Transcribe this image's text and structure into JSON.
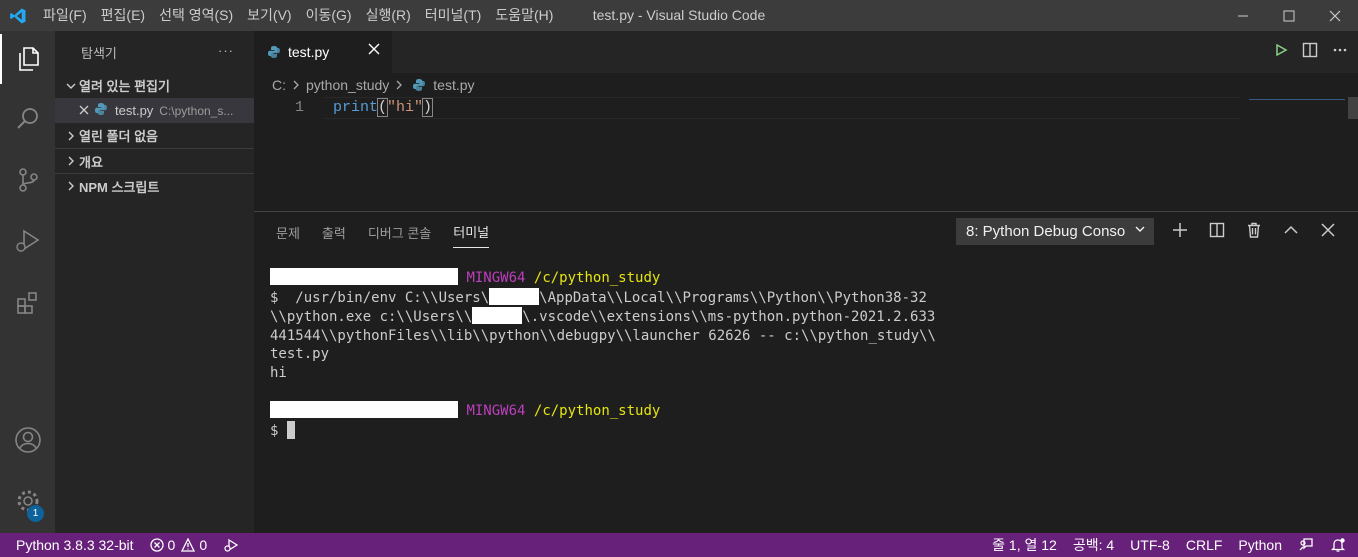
{
  "titlebar": {
    "title": "test.py - Visual Studio Code",
    "menu": [
      "파일(F)",
      "편집(E)",
      "선택 영역(S)",
      "보기(V)",
      "이동(G)",
      "실행(R)",
      "터미널(T)",
      "도움말(H)"
    ]
  },
  "activitybar": {
    "settings_badge": "1"
  },
  "sidebar": {
    "title": "탐색기",
    "more": "···",
    "sections": {
      "open_editors": "열려 있는 편집기",
      "no_folder": "열린 폴더 없음",
      "outline": "개요",
      "npm": "NPM 스크립트"
    },
    "open_file": {
      "name": "test.py",
      "path": "C:\\python_s..."
    }
  },
  "editor": {
    "tab": {
      "label": "test.py"
    },
    "breadcrumb": [
      "C:",
      "python_study",
      "test.py"
    ],
    "line_number": "1",
    "code": {
      "fn": "print",
      "open": "(",
      "str": "\"hi\"",
      "close": ")"
    }
  },
  "panel": {
    "tabs": [
      "문제",
      "출력",
      "디버그 콘솔",
      "터미널"
    ],
    "terminal_select": "8: Python Debug Conso",
    "terminal": {
      "prompt_env": "MINGW64",
      "prompt_path": "/c/python_study",
      "cmd_1a": "$  /usr/bin/env C:\\\\Users\\",
      "cmd_1b": "\\AppData\\\\Local\\\\Programs\\\\Python\\\\Python38-32",
      "cmd_2a": "\\\\python.exe c:\\\\Users\\\\",
      "cmd_2b": "\\.vscode\\\\extensions\\\\ms-python.python-2021.2.633",
      "cmd_3": "441544\\\\pythonFiles\\\\lib\\\\python\\\\debugpy\\\\launcher 62626 -- c:\\\\python_study\\\\",
      "cmd_4": "test.py",
      "output": "hi",
      "prompt_symbol": "$ "
    }
  },
  "statusbar": {
    "python": "Python 3.8.3 32-bit",
    "errors": "0",
    "warnings": "0",
    "position": "줄 1, 열 12",
    "spaces": "공백: 4",
    "encoding": "UTF-8",
    "eol": "CRLF",
    "language": "Python"
  },
  "colors": {
    "statusbar": "#68217a",
    "accent": "#0e639c",
    "terminal_magenta": "#bc3fbc",
    "terminal_yellow": "#e5e510"
  }
}
